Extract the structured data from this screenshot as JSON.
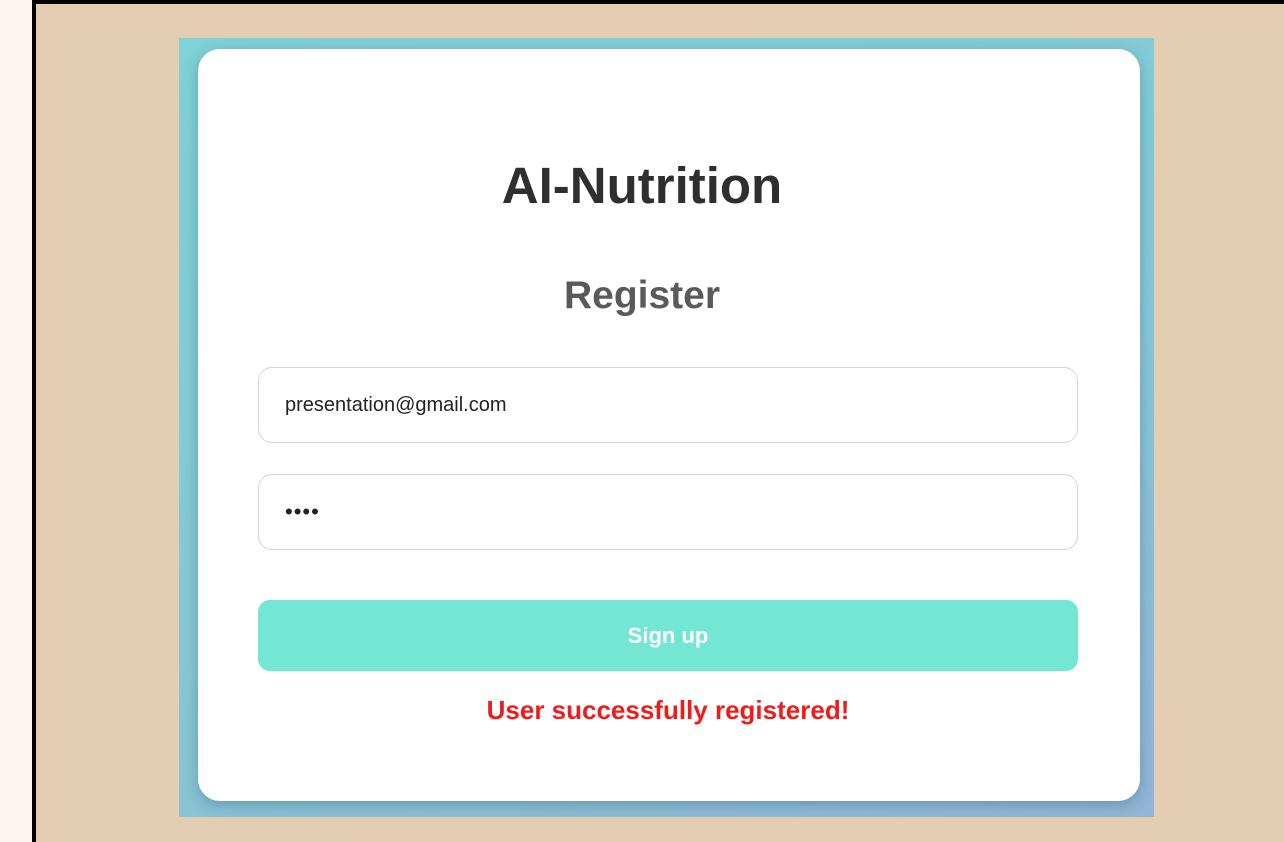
{
  "app": {
    "title": "AI-Nutrition",
    "form_title": "Register"
  },
  "form": {
    "email": {
      "value": "presentation@gmail.com"
    },
    "password": {
      "value": "••••"
    },
    "submit_label": "Sign up"
  },
  "status": {
    "message": "User successfully registered!",
    "color": "#f01c1c"
  },
  "colors": {
    "page_background": "#e3ceb3",
    "panel_gradient": [
      "#7fd2d6",
      "#92b6d6"
    ],
    "button": "#74e6d4",
    "title": "#2f2f2f"
  }
}
